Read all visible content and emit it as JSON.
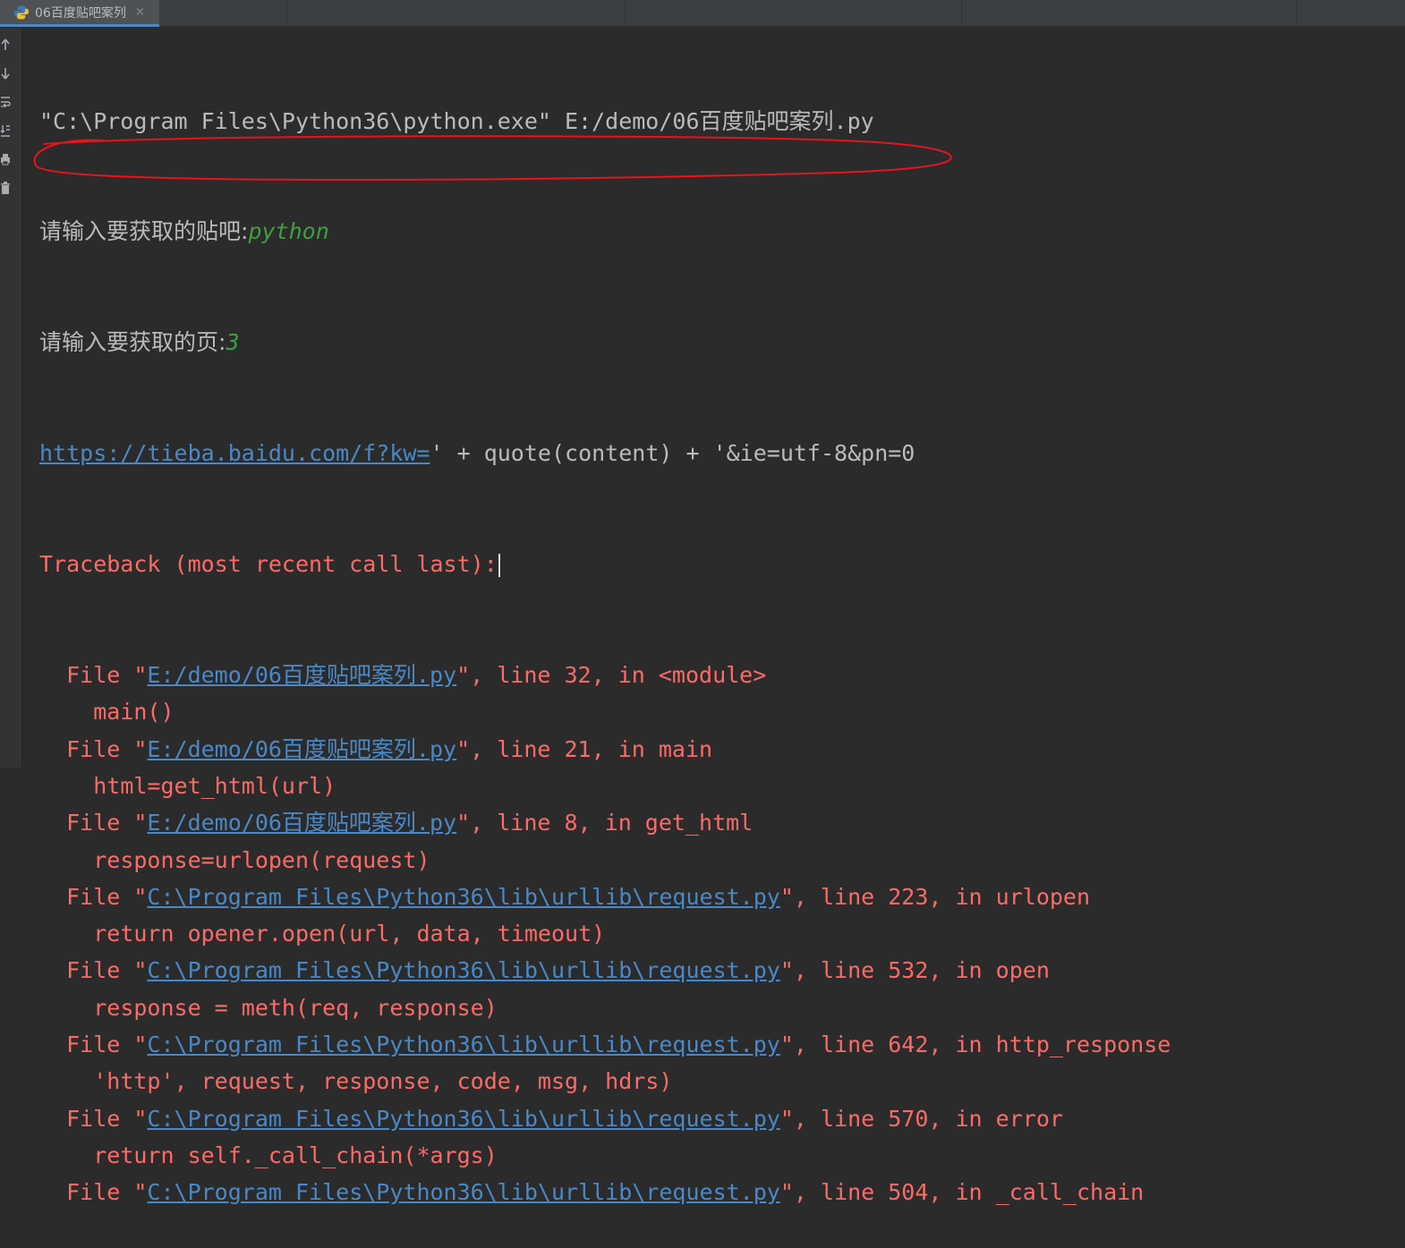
{
  "tab": {
    "label": "06百度贴吧案列",
    "close": "×"
  },
  "colors": {
    "background": "#2b2b2b",
    "error": "#ff6b68",
    "link": "#4a88c7",
    "input": "#3da03d",
    "annotation": "#e8141b"
  },
  "gutter_icons": [
    "scroll-up-icon",
    "scroll-down-icon",
    "soft-wrap-icon",
    "scroll-to-end-icon",
    "print-icon",
    "trash-icon"
  ],
  "console": {
    "command": "\"C:\\Program Files\\Python36\\python.exe\" E:/demo/06百度贴吧案列.py",
    "prompt1": "请输入要获取的贴吧:",
    "input1": "python",
    "prompt2": "请输入要获取的页:",
    "input2": "3",
    "url_link": "https://tieba.baidu.com/f?kw=",
    "url_rest": "' + quote(content) + '&ie=utf-8&pn=0",
    "traceback_header": "Traceback (most recent call last):",
    "frames": [
      {
        "file": "E:/demo/06百度贴吧案列.py",
        "suffix": "\", line 32, in <module>",
        "code": "main()"
      },
      {
        "file": "E:/demo/06百度贴吧案列.py",
        "suffix": "\", line 21, in main",
        "code": "html=get_html(url)"
      },
      {
        "file": "E:/demo/06百度贴吧案列.py",
        "suffix": "\", line 8, in get_html",
        "code": "response=urlopen(request)"
      },
      {
        "file": "C:\\Program Files\\Python36\\lib\\urllib\\request.py",
        "suffix": "\", line 223, in urlopen",
        "code": "return opener.open(url, data, timeout)"
      },
      {
        "file": "C:\\Program Files\\Python36\\lib\\urllib\\request.py",
        "suffix": "\", line 532, in open",
        "code": "response = meth(req, response)"
      },
      {
        "file": "C:\\Program Files\\Python36\\lib\\urllib\\request.py",
        "suffix": "\", line 642, in http_response",
        "code": "'http', request, response, code, msg, hdrs)"
      },
      {
        "file": "C:\\Program Files\\Python36\\lib\\urllib\\request.py",
        "suffix": "\", line 570, in error",
        "code": "return self._call_chain(*args)"
      },
      {
        "file": "C:\\Program Files\\Python36\\lib\\urllib\\request.py",
        "suffix": "\", line 504, in _call_chain",
        "code": ""
      }
    ],
    "file_prefix": "File \""
  }
}
